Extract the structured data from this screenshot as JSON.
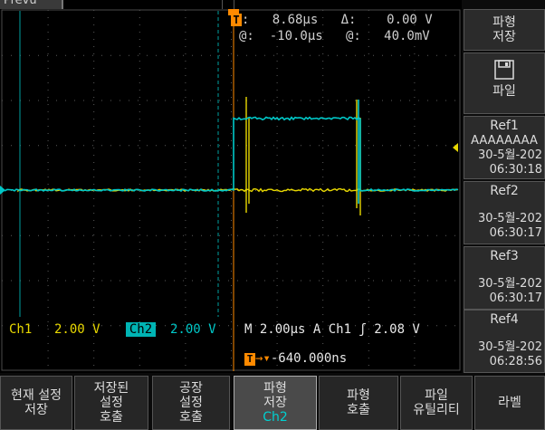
{
  "top": {
    "mode": "Prevu"
  },
  "cursors": {
    "t_label": "T",
    "row1": ":   8.68µs   Δ:    0.00 V",
    "row2": "@:  -10.0µs   @:   40.0mV"
  },
  "channels": {
    "ch1_label": "Ch1",
    "ch1_volts": "2.00 V",
    "ch2_label": "Ch2",
    "ch2_volts": "2.00 V",
    "horizontal": "M 2.00µs  A  Ch1  ʃ   2.08 V",
    "trigger_position": "-640.000ns",
    "trigger_icon": "T→▼"
  },
  "colors": {
    "ch1": "#e8d800",
    "ch2": "#00c8c8",
    "grid": "#5a5a5a"
  },
  "side_menu": {
    "save_waveform": {
      "line1": "파형",
      "line2": "저장"
    },
    "file": {
      "label": "파일",
      "icon": "floppy-disk-icon"
    },
    "refs": [
      {
        "name": "Ref1",
        "line": "AAAAAAAA",
        "date": "30-5월-202",
        "time": "06:30:18"
      },
      {
        "name": "Ref2",
        "date": "30-5월-202",
        "time": "06:30:17"
      },
      {
        "name": "Ref3",
        "date": "30-5월-202",
        "time": "06:30:17"
      },
      {
        "name": "Ref4",
        "date": "30-5월-202",
        "time": "06:28:56"
      }
    ]
  },
  "bottom_menu": [
    {
      "line1": "현재 설정",
      "line2": "저장"
    },
    {
      "line1": "저장된",
      "line2": "설정",
      "line3": "호출"
    },
    {
      "line1": "공장",
      "line2": "설정",
      "line3": "호출"
    },
    {
      "line1": "파형",
      "line2": "저장",
      "line3": "Ch2"
    },
    {
      "line1": "파형",
      "line2": "호출"
    },
    {
      "line1": "파일",
      "line2": "유틸리티"
    },
    {
      "line1": "라벨"
    }
  ]
}
